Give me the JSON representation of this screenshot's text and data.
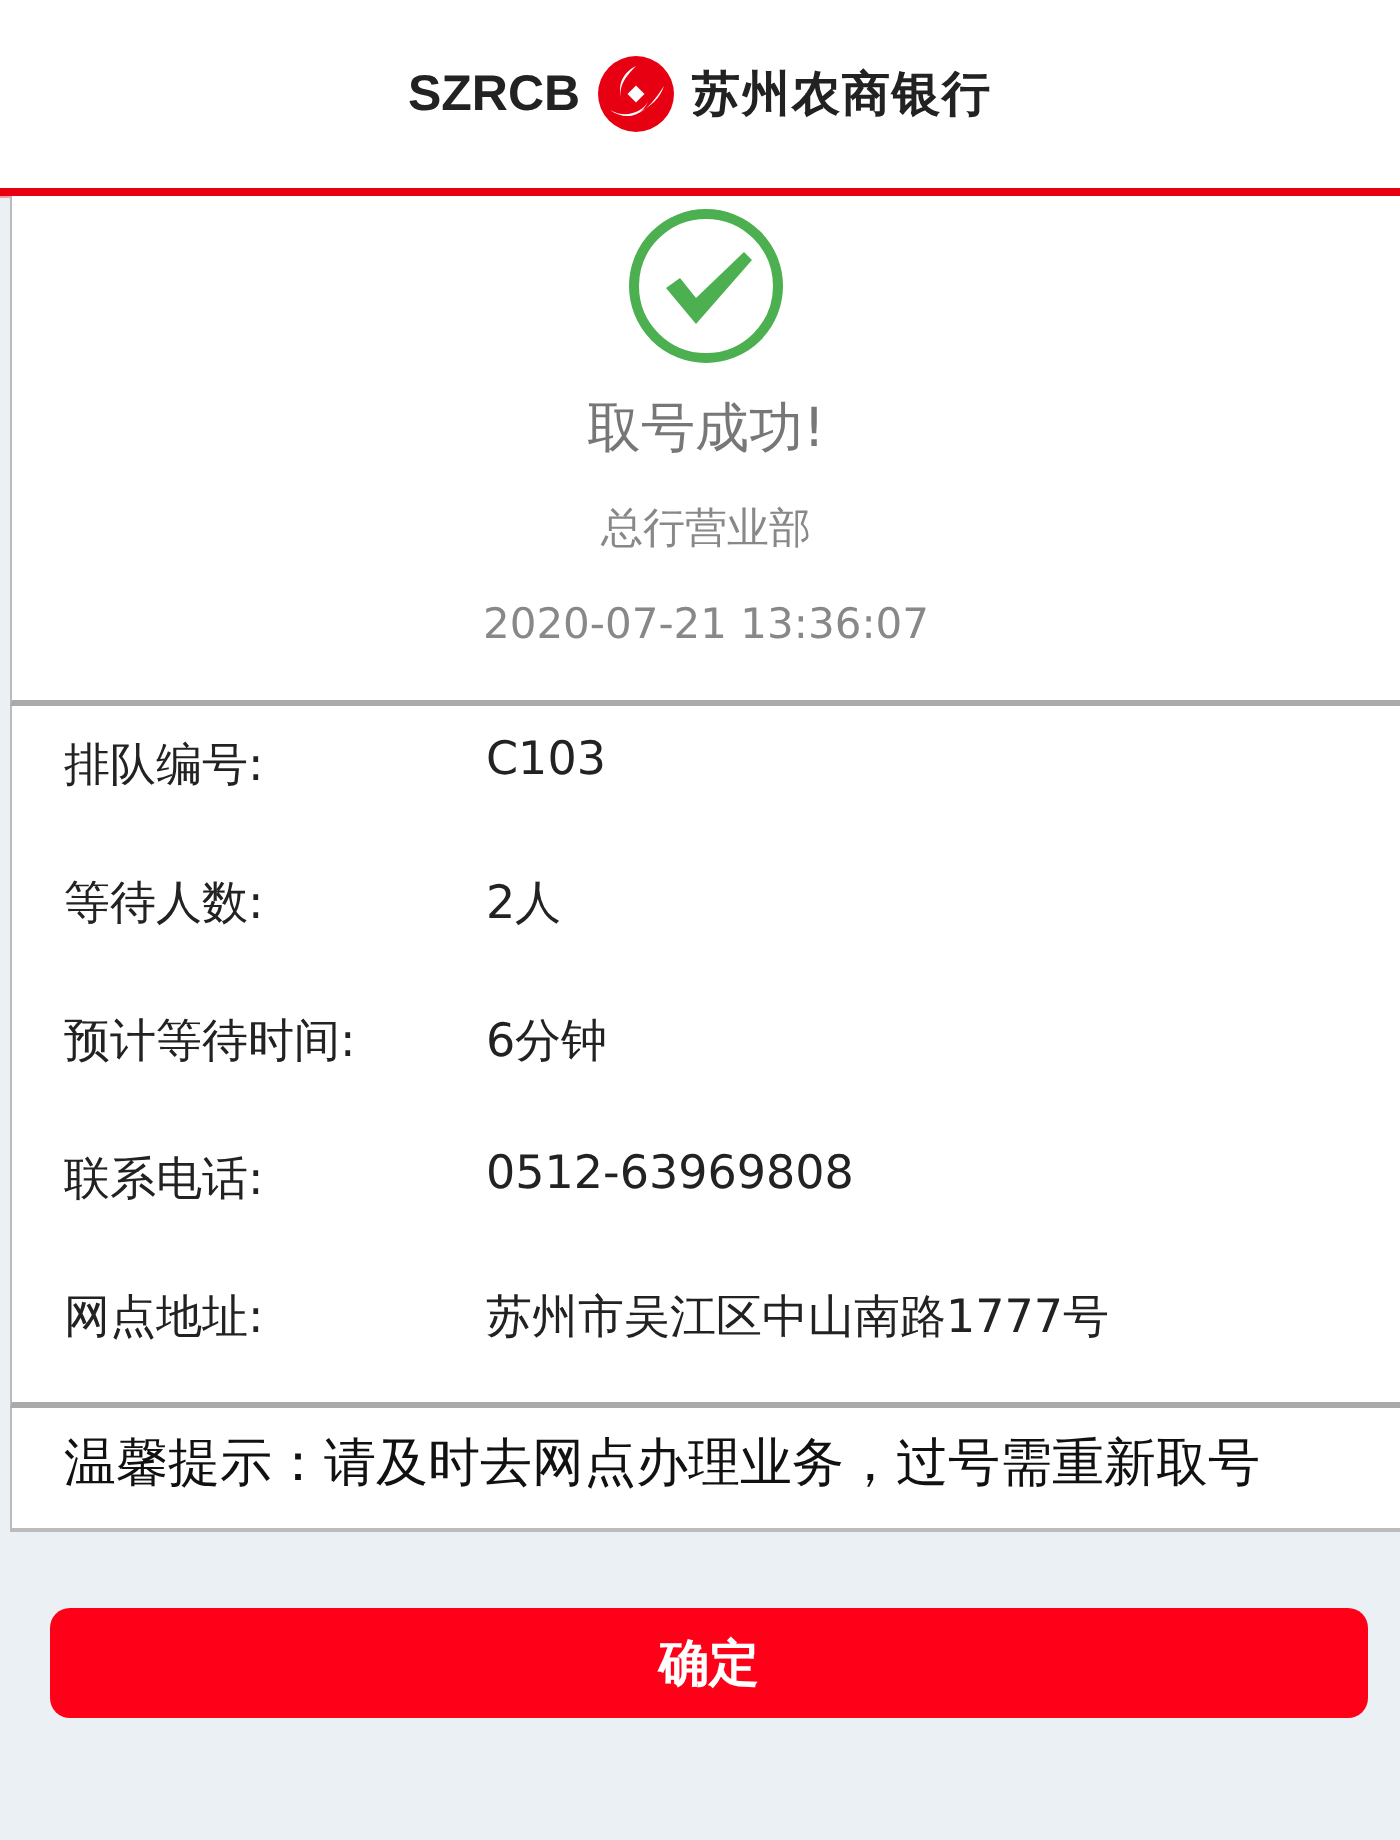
{
  "header": {
    "brand_latin": "SZRCB",
    "brand_name": "苏州农商银行"
  },
  "result": {
    "success": true,
    "title": "取号成功!",
    "branch": "总行营业部",
    "time": "2020-07-21 13:36:07"
  },
  "details": [
    {
      "label": "排队编号:",
      "value": "C103"
    },
    {
      "label": "等待人数:",
      "value": "2人"
    },
    {
      "label": "预计等待时间:",
      "value": "6分钟"
    },
    {
      "label": "联系电话:",
      "value": "0512-63969808"
    },
    {
      "label": "网点地址:",
      "value": "苏州市吴江区中山南路1777号"
    }
  ],
  "notice": "温馨提示：请及时去网点办理业务，过号需重新取号",
  "button": "确定"
}
